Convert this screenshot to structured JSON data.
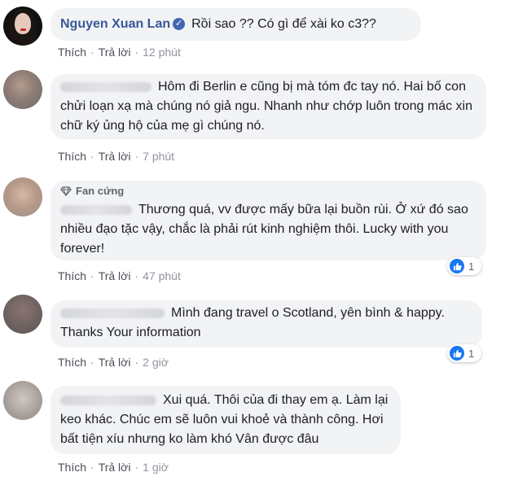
{
  "comments": [
    {
      "author": "Nguyen Xuan Lan",
      "text": "Rồi sao ?? Có gì để xài ko c3??",
      "actions": {
        "like": "Thích",
        "reply": "Trả lời",
        "time": "12 phút"
      }
    },
    {
      "text": "Hôm đi Berlin e cũng bị mà tóm đc tay nó. Hai bố con chửi loạn xạ mà chúng nó giả ngu. Nhanh như chớp luôn trong mác xin chữ ký ủng hộ của mẹ gì chúng nó.",
      "actions": {
        "like": "Thích",
        "reply": "Trả lời",
        "time": "7 phút"
      }
    },
    {
      "badge": "Fan cứng",
      "text": "Thương quá, vv được mấy bữa lại buồn rùi. Ở xứ đó sao nhiều đạo tặc vậy, chắc là phải rút kinh nghiệm thôi. Lucky with you forever!",
      "reactions": "1",
      "actions": {
        "like": "Thích",
        "reply": "Trả lời",
        "time": "47 phút"
      }
    },
    {
      "text": "Mình đang travel o Scotland, yên bình & happy. Thanks Your information",
      "reactions": "1",
      "actions": {
        "like": "Thích",
        "reply": "Trả lời",
        "time": "2 giờ"
      }
    },
    {
      "text": "Xui quá. Thôi của đi thay em ạ. Làm lại keo khác. Chúc em sẽ luôn vui khoẻ và thành công. Hơi bất tiện xíu nhưng ko làm khó Vân được đâu",
      "actions": {
        "like": "Thích",
        "reply": "Trả lời",
        "time": "1 giờ"
      }
    }
  ],
  "colors": {
    "link": "#385898",
    "bubble": "#f2f3f5",
    "meta": "#606770",
    "like": "#1877f2"
  },
  "icons": {
    "verified": "verified-check-icon",
    "fan": "diamond-icon",
    "reaction": "thumbs-up-icon"
  }
}
